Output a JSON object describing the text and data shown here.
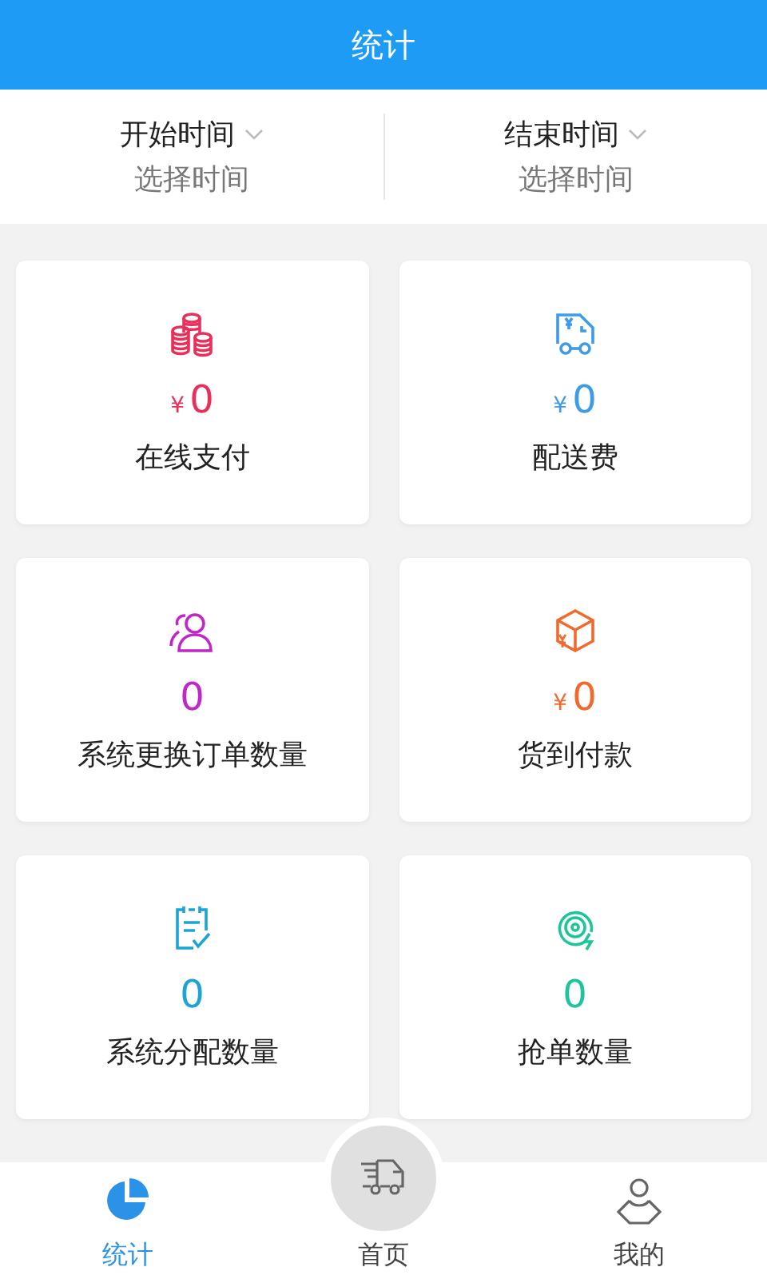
{
  "header": {
    "title": "统计"
  },
  "date_filters": [
    {
      "label": "开始时间",
      "placeholder": "选择时间"
    },
    {
      "label": "结束时间",
      "placeholder": "选择时间"
    }
  ],
  "stats": [
    {
      "kind": "coins",
      "color": "#e8305a",
      "currency": "¥",
      "value": "0",
      "label": "在线支付"
    },
    {
      "kind": "van",
      "color": "#3e9be6",
      "currency": "¥",
      "value": "0",
      "label": "配送费"
    },
    {
      "kind": "people",
      "color": "#c027c9",
      "value": "0",
      "label": "系统更换订单数量"
    },
    {
      "kind": "box",
      "color": "#f06a2e",
      "currency": "¥",
      "value": "0",
      "label": "货到付款"
    },
    {
      "kind": "clipboard",
      "color": "#1fa3d4",
      "value": "0",
      "label": "系统分配数量"
    },
    {
      "kind": "target",
      "color": "#1fc59a",
      "value": "0",
      "label": "抢单数量"
    }
  ],
  "bottom_nav": [
    {
      "kind": "pie",
      "label": "统计",
      "selected": true
    },
    {
      "kind": "truck",
      "label": "首页",
      "selected": false
    },
    {
      "kind": "person",
      "label": "我的",
      "selected": false
    }
  ]
}
